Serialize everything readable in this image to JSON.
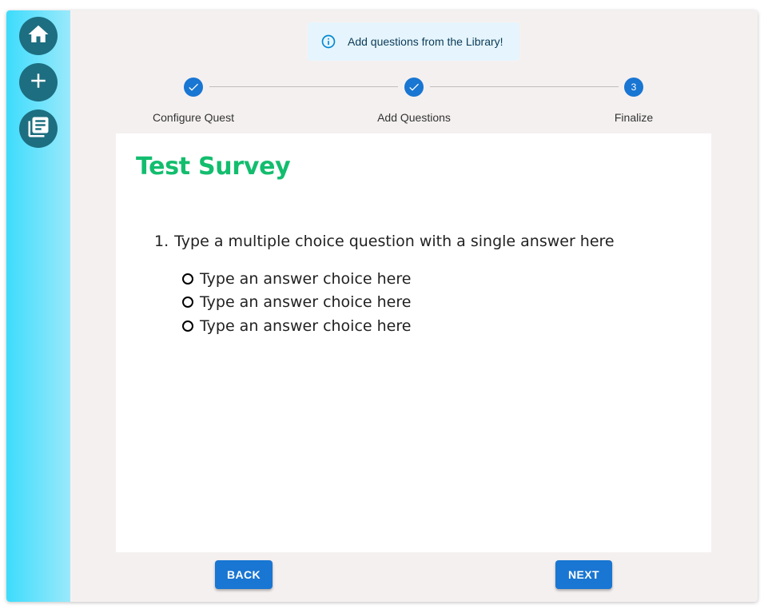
{
  "sidebar": {
    "items": [
      {
        "icon": "home-icon"
      },
      {
        "icon": "plus-icon"
      },
      {
        "icon": "library-icon"
      }
    ],
    "gradient_start": "#3ddcfc",
    "gradient_end": "#9ae9fb",
    "button_color": "#1d6e80"
  },
  "banner": {
    "icon": "info-icon",
    "text": "Add questions from the Library!"
  },
  "stepper": {
    "steps": [
      {
        "label": "Configure Quest",
        "state": "completed"
      },
      {
        "label": "Add Questions",
        "state": "completed"
      },
      {
        "label": "Finalize",
        "state": "active",
        "number": "3"
      }
    ],
    "accent": "#1976d2"
  },
  "survey": {
    "title": "Test Survey",
    "title_color": "#13bd6e",
    "question": {
      "number": "1.",
      "text": "Type a multiple choice question with a single answer here",
      "choices": [
        "Type an answer choice here",
        "Type an answer choice here",
        "Type an answer choice here"
      ]
    }
  },
  "actions": {
    "back_label": "BACK",
    "next_label": "NEXT"
  }
}
